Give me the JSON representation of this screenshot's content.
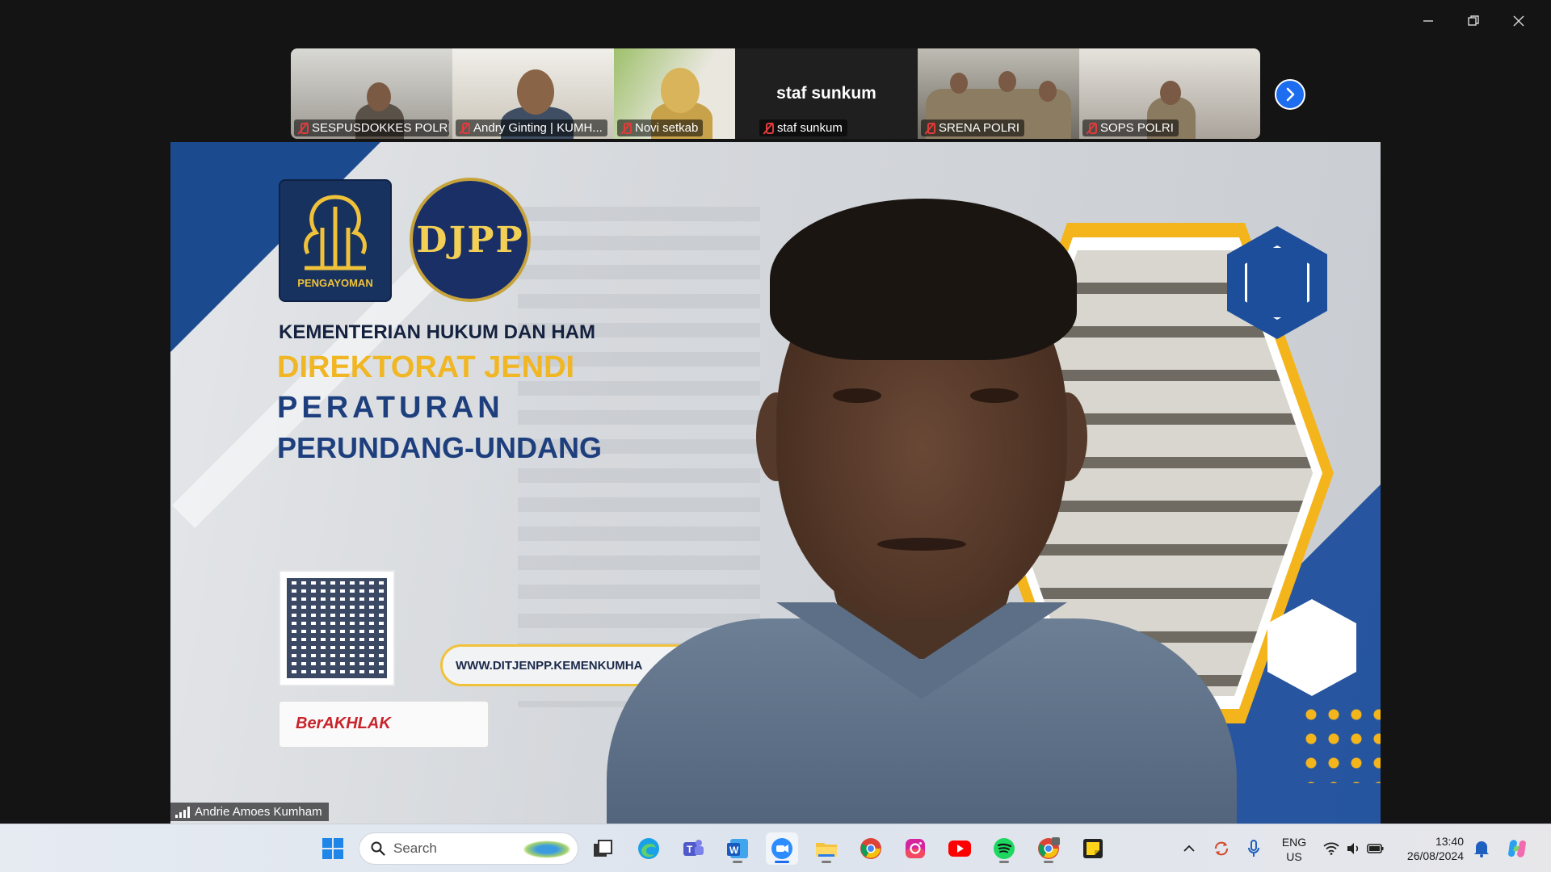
{
  "window": {
    "controls": [
      {
        "name": "minimize-icon"
      },
      {
        "name": "restore-icon"
      },
      {
        "name": "close-icon"
      }
    ]
  },
  "participants": [
    {
      "name": "SESPUSDOKKES POLRI",
      "muted": true
    },
    {
      "name": "Andry Ginting | KUMH...",
      "muted": true
    },
    {
      "name": "Novi setkab",
      "muted": true
    },
    {
      "name": "staf sunkum",
      "muted": true,
      "video_off": true,
      "display_name": "staf sunkum"
    },
    {
      "name": "SRENA POLRI",
      "muted": true
    },
    {
      "name": "SOPS POLRI",
      "muted": true
    }
  ],
  "strip_next_icon": "chevron-right-icon",
  "slide": {
    "logo1_text": "PENGAYOMAN",
    "logo2_text": "DJPP",
    "line1": "KEMENTERIAN HUKUM DAN HAM",
    "line2": "DIREKTORAT JENDI",
    "line3": "PERATURAN",
    "line4": "PERUNDANG-UNDANG",
    "url": "WWW.DITJENPP.KEMENKUMHA",
    "badge": "BerAKHLAK"
  },
  "active_speaker": {
    "name": "Andrie Amoes Kumham"
  },
  "taskbar": {
    "search_placeholder": "Search",
    "apps": [
      "windows-start-icon",
      "task-view-icon",
      "edge-icon",
      "teams-icon",
      "word-icon",
      "zoom-icon",
      "file-explorer-icon",
      "chrome-icon",
      "instagram-icon",
      "youtube-icon",
      "spotify-icon",
      "chrome-profile-icon",
      "sticky-notes-icon"
    ],
    "tray": {
      "language_line1": "ENG",
      "language_line2": "US",
      "time": "13:40",
      "date": "26/08/2024"
    }
  },
  "colors": {
    "zoom_blue": "#1d6df0",
    "mute_red": "#e23b3b",
    "slide_gold": "#f0b623",
    "slide_navy": "#1e3f7d"
  }
}
